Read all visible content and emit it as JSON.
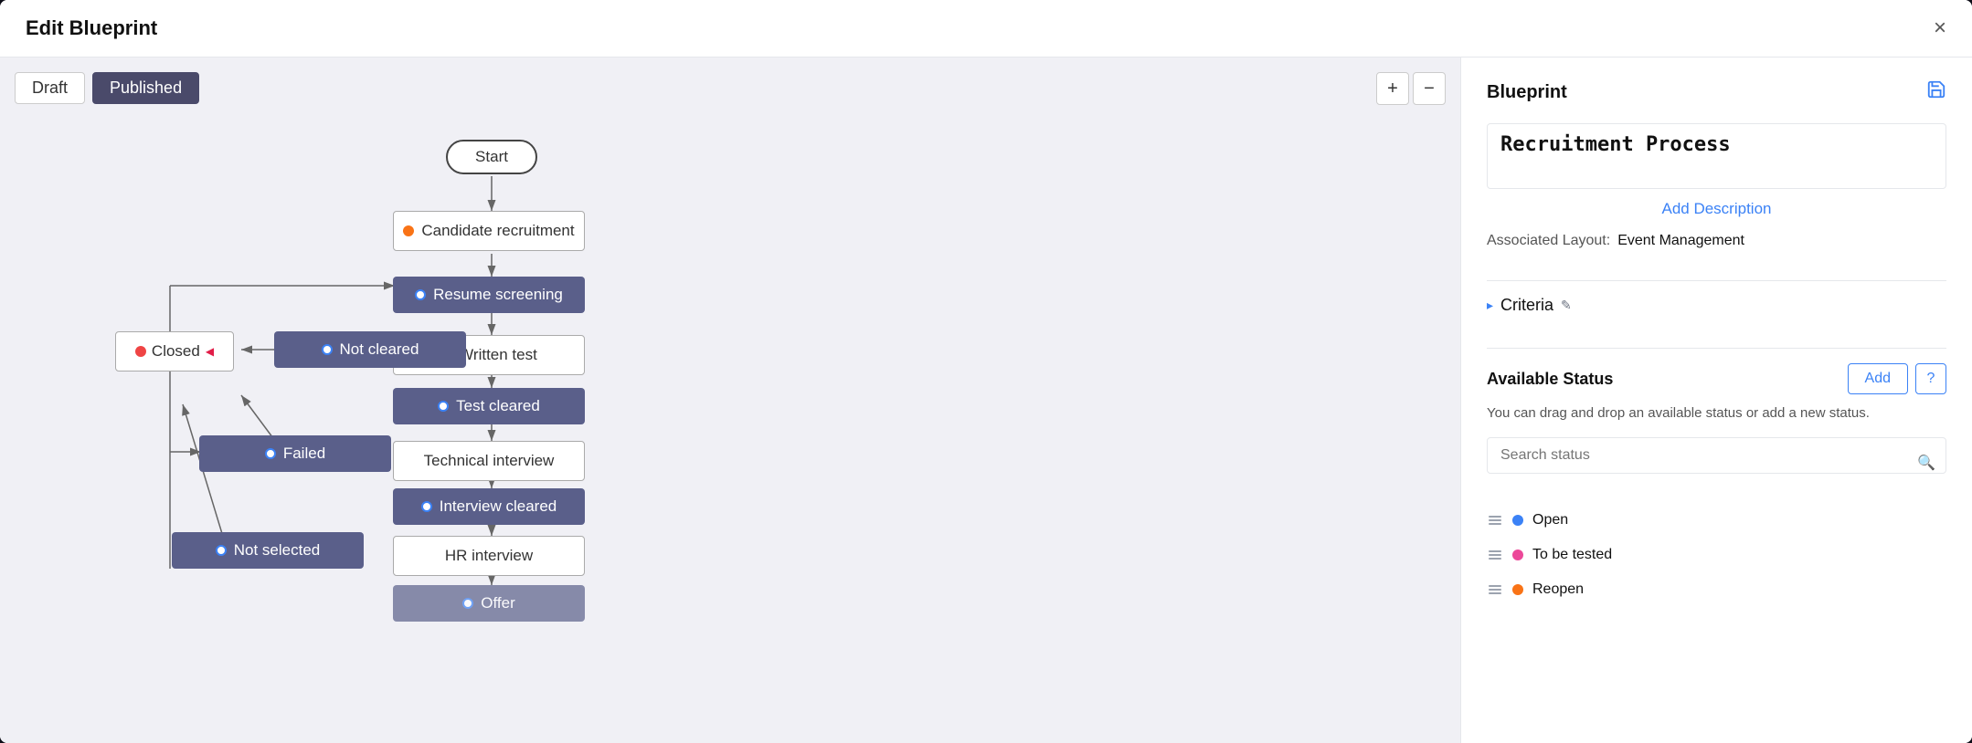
{
  "modal": {
    "title": "Edit Blueprint",
    "close_label": "×"
  },
  "tabs": {
    "draft": "Draft",
    "published": "Published",
    "active": "published"
  },
  "zoom": {
    "plus": "+",
    "minus": "−"
  },
  "nodes": [
    {
      "id": "start",
      "label": "Start",
      "type": "start"
    },
    {
      "id": "candidate-recruitment",
      "label": "Candidate recruitment",
      "type": "white",
      "dot": "orange"
    },
    {
      "id": "resume-screening",
      "label": "Resume screening",
      "type": "dark",
      "dot": "blue-outline"
    },
    {
      "id": "written-test",
      "label": "Written test",
      "type": "white",
      "dot": "blue-outline"
    },
    {
      "id": "not-cleared",
      "label": "Not cleared",
      "type": "dark",
      "dot": "blue-outline"
    },
    {
      "id": "test-cleared",
      "label": "Test cleared",
      "type": "dark",
      "dot": "blue-outline"
    },
    {
      "id": "closed",
      "label": "Closed",
      "type": "closed",
      "dot": "red"
    },
    {
      "id": "failed",
      "label": "Failed",
      "type": "dark",
      "dot": "blue-outline"
    },
    {
      "id": "technical-interview",
      "label": "Technical interview",
      "type": "white"
    },
    {
      "id": "interview-cleared",
      "label": "Interview cleared",
      "type": "dark",
      "dot": "blue-outline"
    },
    {
      "id": "not-selected",
      "label": "Not selected",
      "type": "dark",
      "dot": "blue-outline"
    },
    {
      "id": "hr-interview",
      "label": "HR interview",
      "type": "white"
    },
    {
      "id": "offer",
      "label": "Offer",
      "type": "dark",
      "dot": "blue-outline"
    }
  ],
  "right_panel": {
    "title": "Blueprint",
    "blueprint_name": "Recruitment Process",
    "add_description": "Add Description",
    "associated_layout_label": "Associated Layout:",
    "associated_layout_value": "Event Management",
    "criteria_label": "Criteria",
    "available_status_title": "Available Status",
    "add_btn": "Add",
    "help_btn": "?",
    "drag_info": "You can drag and drop an available status or add a new status.",
    "search_placeholder": "Search status",
    "statuses": [
      {
        "label": "Open",
        "color": "blue"
      },
      {
        "label": "To be tested",
        "color": "pink"
      },
      {
        "label": "Reopen",
        "color": "orange"
      }
    ]
  }
}
